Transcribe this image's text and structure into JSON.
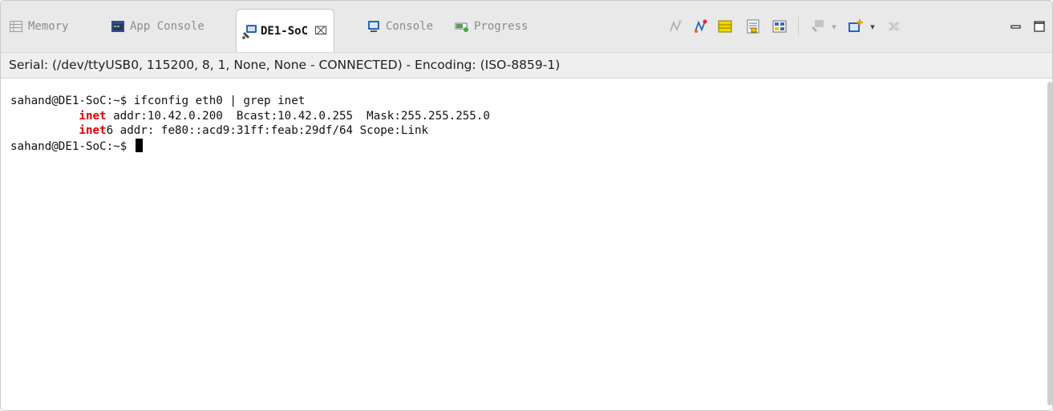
{
  "tabs": [
    {
      "label": "Memory",
      "icon": "memory-icon"
    },
    {
      "label": "App Console",
      "icon": "app-console-icon"
    },
    {
      "label": "DE1-SoC",
      "icon": "terminal-icon",
      "active": true,
      "close": "⌧"
    },
    {
      "label": "Console",
      "icon": "console-icon"
    },
    {
      "label": "Progress",
      "icon": "progress-icon"
    }
  ],
  "toolbar": {
    "icons": [
      "connect-icon",
      "disconnect-icon",
      "settings-icon",
      "scroll-lock-icon",
      "select-all-icon",
      "new-terminal-icon",
      "new-terminal-dropdown-icon",
      "open-console-icon",
      "open-console-dropdown-icon",
      "remove-icon",
      "minimize-icon",
      "maximize-icon"
    ]
  },
  "status": {
    "text": "Serial: (/dev/ttyUSB0, 115200, 8, 1, None, None - CONNECTED) - Encoding: (ISO-8859-1)"
  },
  "terminal": {
    "line1": "sahand@DE1-SoC:~$ ifconfig eth0 | grep inet",
    "line2_indent": "          ",
    "line2_kw": "inet",
    "line2_rest": " addr:10.42.0.200  Bcast:10.42.0.255  Mask:255.255.255.0",
    "line3_indent": "          ",
    "line3_kw": "inet",
    "line3_rest": "6 addr: fe80::acd9:31ff:feab:29df/64 Scope:Link",
    "line4": "sahand@DE1-SoC:~$ "
  },
  "colors": {
    "keyword": "#e00000",
    "accent_yellow": "#f2d600",
    "accent_blue": "#2a63b8"
  }
}
